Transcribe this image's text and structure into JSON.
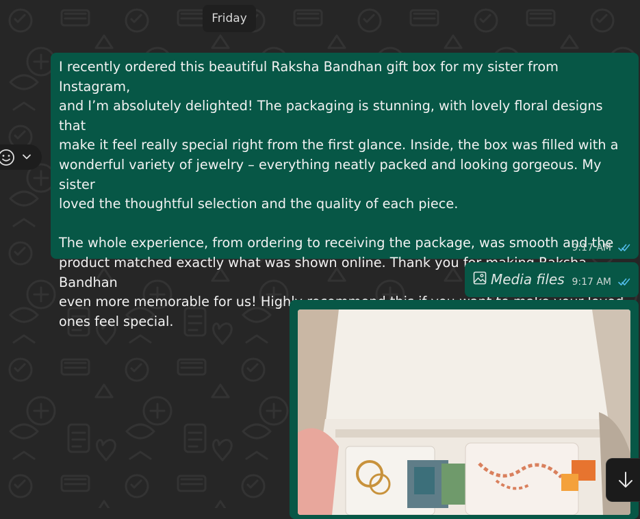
{
  "chat": {
    "date_divider": "Friday",
    "messages": [
      {
        "type": "text",
        "text": "I recently ordered this beautiful Raksha Bandhan gift box for my sister from Instagram,\nand I’m absolutely delighted! The packaging is stunning, with lovely floral designs that\nmake it feel really special right from the first glance. Inside, the box was filled with a\nwonderful variety of jewelry – everything neatly packed and looking gorgeous. My sister\nloved the thoughtful selection and the quality of each piece.\n\nThe whole experience, from ordering to receiving the package, was smooth and the\nproduct matched exactly what was shown online. Thank you for making Raksha Bandhan\neven more memorable for us! Highly recommend this if you want to make your loved\nones feel special.",
        "time": "9:17 AM",
        "status": "read"
      },
      {
        "type": "media_label",
        "label": "Media files",
        "time": "9:17 AM",
        "status": "read"
      },
      {
        "type": "image",
        "description_icon": "photo"
      }
    ]
  },
  "icons": {
    "reaction": "smiley-icon",
    "menu": "chevron-down-icon",
    "read_receipt": "double-check-icon",
    "media": "image-icon",
    "scroll": "arrow-down-icon"
  },
  "colors": {
    "background": "#262626",
    "outgoing_bubble": "#075746",
    "read_tick": "#53bdeb",
    "text": "#f2f2f2"
  }
}
